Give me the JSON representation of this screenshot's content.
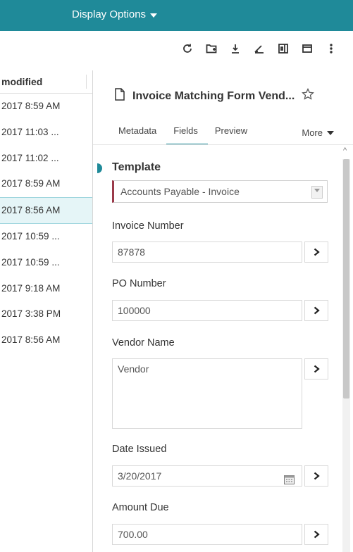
{
  "topbar": {
    "display_options": "Display Options"
  },
  "toolbar": {
    "icons": [
      "refresh-icon",
      "add-folder-icon",
      "download-icon",
      "edit-icon",
      "columns-icon",
      "message-icon",
      "more-vertical-icon"
    ]
  },
  "list": {
    "header": "modified",
    "rows": [
      "2017 8:59 AM",
      "2017 11:03 ...",
      "2017 11:02 ...",
      "2017 8:59 AM",
      "2017 8:56 AM",
      "2017 10:59 ...",
      "2017 10:59 ...",
      "2017 9:18 AM",
      "2017 3:38 PM",
      "2017 8:56 AM"
    ],
    "selected_index": 4
  },
  "document": {
    "title": "Invoice Matching Form Vend..."
  },
  "tabs": {
    "metadata": "Metadata",
    "fields": "Fields",
    "preview": "Preview",
    "more": "More"
  },
  "form": {
    "template_label": "Template",
    "template_value": "Accounts Payable - Invoice",
    "invoice_number_label": "Invoice Number",
    "invoice_number_value": "87878",
    "po_number_label": "PO Number",
    "po_number_value": "100000",
    "vendor_name_label": "Vendor Name",
    "vendor_name_value": "Vendor",
    "date_issued_label": "Date Issued",
    "date_issued_value": "3/20/2017",
    "amount_due_label": "Amount Due",
    "amount_due_value": "700.00"
  },
  "colors": {
    "accent": "#1f8a99",
    "template_marker": "#9b3a4a",
    "selected_row": "#e5f5f7"
  }
}
